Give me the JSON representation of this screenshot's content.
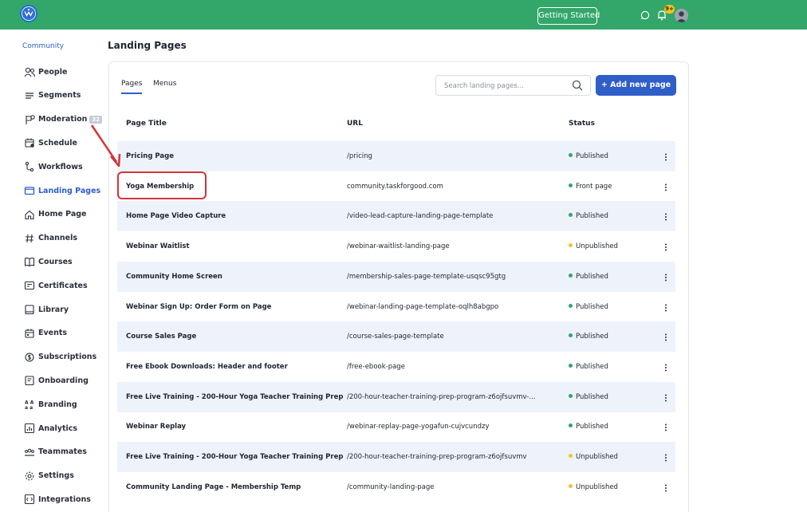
{
  "header": {
    "getting_started_label": "Getting Started",
    "notification_badge": "9+",
    "brand_color": "#33a66a"
  },
  "sidebar": {
    "community_label": "Community",
    "items": [
      {
        "label": "People",
        "icon": "people-icon"
      },
      {
        "label": "Segments",
        "icon": "segments-icon"
      },
      {
        "label": "Moderation",
        "icon": "moderation-icon",
        "badge": "32"
      },
      {
        "label": "Schedule",
        "icon": "schedule-icon"
      },
      {
        "label": "Workflows",
        "icon": "workflows-icon"
      },
      {
        "label": "Landing Pages",
        "icon": "landing-pages-icon",
        "active": true
      },
      {
        "label": "Home Page",
        "icon": "home-icon"
      },
      {
        "label": "Channels",
        "icon": "hash-icon"
      },
      {
        "label": "Courses",
        "icon": "book-icon"
      },
      {
        "label": "Certificates",
        "icon": "certificate-icon"
      },
      {
        "label": "Library",
        "icon": "library-icon"
      },
      {
        "label": "Events",
        "icon": "calendar-icon"
      },
      {
        "label": "Subscriptions",
        "icon": "subscriptions-icon"
      },
      {
        "label": "Onboarding",
        "icon": "onboarding-icon"
      },
      {
        "label": "Branding",
        "icon": "branding-icon"
      },
      {
        "label": "Analytics",
        "icon": "analytics-icon"
      },
      {
        "label": "Teammates",
        "icon": "teammates-icon"
      },
      {
        "label": "Settings",
        "icon": "gear-icon"
      },
      {
        "label": "Integrations",
        "icon": "integrations-icon"
      }
    ]
  },
  "main": {
    "title": "Landing Pages",
    "tabs": [
      {
        "label": "Pages",
        "active": true
      },
      {
        "label": "Menus",
        "active": false
      }
    ],
    "search": {
      "placeholder": "Search landing pages..."
    },
    "add_button_label": "+ Add new page",
    "table": {
      "columns": [
        "Page Title",
        "URL",
        "Status"
      ],
      "rows": [
        {
          "title": "Pricing Page",
          "url": "/pricing",
          "status": "Published"
        },
        {
          "title": "Yoga Membership",
          "url": "community.taskforgood.com",
          "status": "Front page"
        },
        {
          "title": "Home Page Video Capture",
          "url": "/video-lead-capture-landing-page-template",
          "status": "Published"
        },
        {
          "title": "Webinar Waitlist",
          "url": "/webinar-waitlist-landing-page",
          "status": "Unpublished"
        },
        {
          "title": "Community Home Screen",
          "url": "/membership-sales-page-template-usqsc95gtg",
          "status": "Published"
        },
        {
          "title": "Webinar Sign Up: Order Form on Page",
          "url": "/webinar-landing-page-template-oqlh8abgpo",
          "status": "Published"
        },
        {
          "title": "Course Sales Page",
          "url": "/course-sales-page-template",
          "status": "Published"
        },
        {
          "title": "Free Ebook Downloads: Header and footer",
          "url": "/free-ebook-page",
          "status": "Published"
        },
        {
          "title": "Free Live Training - 200-Hour Yoga Teacher Training Prep",
          "url": "/200-hour-teacher-training-prep-program-z6ojfsuvmv-...",
          "status": "Published"
        },
        {
          "title": "Webinar Replay",
          "url": "/webinar-replay-page-yogafun-cujvcundzy",
          "status": "Published"
        },
        {
          "title": "Free Live Training - 200-Hour Yoga Teacher Training Prep",
          "url": "/200-hour-teacher-training-prep-program-z6ojfsuvmv",
          "status": "Unpublished"
        },
        {
          "title": "Community Landing Page - Membership Temp",
          "url": "/community-landing-page",
          "status": "Unpublished"
        }
      ]
    },
    "status_colors": {
      "published": "#33a66a",
      "front_page": "#33a66a",
      "unpublished": "#f2c230"
    }
  }
}
